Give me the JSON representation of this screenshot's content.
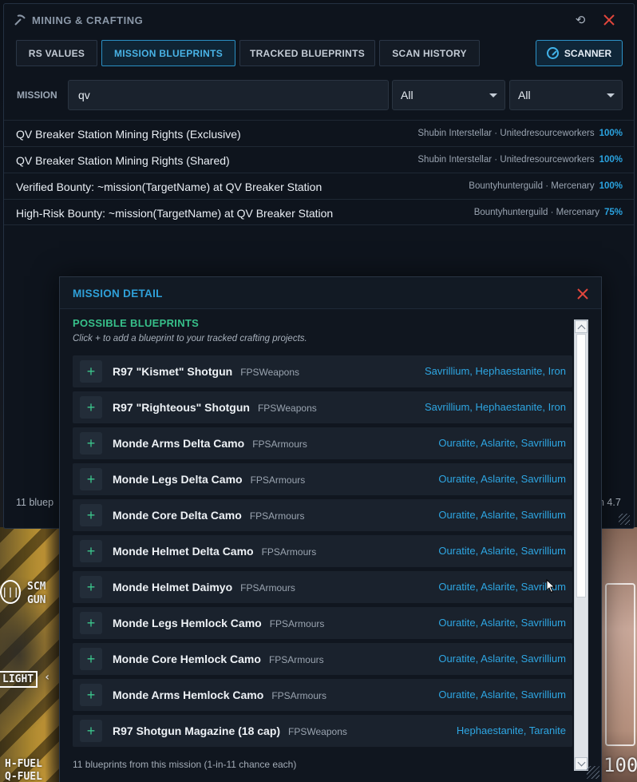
{
  "window": {
    "title": "MINING & CRAFTING",
    "tabs": [
      {
        "label": "RS VALUES",
        "active": false
      },
      {
        "label": "MISSION BLUEPRINTS",
        "active": true
      },
      {
        "label": "TRACKED BLUEPRINTS",
        "active": false
      },
      {
        "label": "SCAN HISTORY",
        "active": false
      }
    ],
    "scanner_label": "SCANNER"
  },
  "filters": {
    "label": "MISSION",
    "search_value": "qv",
    "select_1": "All",
    "select_2": "All"
  },
  "results": [
    {
      "title": "QV Breaker Station Mining Rights (Exclusive)",
      "company": "Shubin Interstellar",
      "faction": "Unitedresourceworkers",
      "chance": "100%"
    },
    {
      "title": "QV Breaker Station Mining Rights (Shared)",
      "company": "Shubin Interstellar",
      "faction": "Unitedresourceworkers",
      "chance": "100%"
    },
    {
      "title": "Verified Bounty: ~mission(TargetName) at QV Breaker Station",
      "company": "Bountyhunterguild",
      "faction": "Mercenary",
      "chance": "100%"
    },
    {
      "title": "High-Risk Bounty: ~mission(TargetName) at QV Breaker Station",
      "company": "Bountyhunterguild",
      "faction": "Mercenary",
      "chance": "75%"
    }
  ],
  "footer": {
    "left": "11 bluep",
    "right": "n 4.7"
  },
  "modal": {
    "title": "MISSION DETAIL",
    "section_title": "POSSIBLE BLUEPRINTS",
    "hint": "Click + to add a blueprint to your tracked crafting projects.",
    "add_symbol": "+",
    "blueprints": [
      {
        "name": "R97 \"Kismet\" Shotgun",
        "category": "FPSWeapons",
        "materials": "Savrillium, Hephaestanite, Iron"
      },
      {
        "name": "R97 \"Righteous\" Shotgun",
        "category": "FPSWeapons",
        "materials": "Savrillium, Hephaestanite, Iron"
      },
      {
        "name": "Monde Arms Delta Camo",
        "category": "FPSArmours",
        "materials": "Ouratite, Aslarite, Savrillium"
      },
      {
        "name": "Monde Legs Delta Camo",
        "category": "FPSArmours",
        "materials": "Ouratite, Aslarite, Savrillium"
      },
      {
        "name": "Monde Core Delta Camo",
        "category": "FPSArmours",
        "materials": "Ouratite, Aslarite, Savrillium"
      },
      {
        "name": "Monde Helmet Delta Camo",
        "category": "FPSArmours",
        "materials": "Ouratite, Aslarite, Savrillium"
      },
      {
        "name": "Monde Helmet Daimyo",
        "category": "FPSArmours",
        "materials": "Ouratite, Aslarite, Savrillium"
      },
      {
        "name": "Monde Legs Hemlock Camo",
        "category": "FPSArmours",
        "materials": "Ouratite, Aslarite, Savrillium"
      },
      {
        "name": "Monde Core Hemlock Camo",
        "category": "FPSArmours",
        "materials": "Ouratite, Aslarite, Savrillium"
      },
      {
        "name": "Monde Arms Hemlock Camo",
        "category": "FPSArmours",
        "materials": "Ouratite, Aslarite, Savrillium"
      },
      {
        "name": "R97 Shotgun Magazine (18 cap)",
        "category": "FPSWeapons",
        "materials": "Hephaestanite, Taranite"
      }
    ],
    "footer": "11 blueprints from this mission (1-in-11 chance each)"
  },
  "hud": {
    "scm": "SCM",
    "gun": "GUN",
    "light": "LIGHT",
    "hfuel": "H-FUEL",
    "qfuel": "Q-FUEL",
    "value": "100"
  },
  "colors": {
    "accent": "#2fa0d8",
    "section_green": "#37c08a",
    "close_red": "#e2463c",
    "panel_bg": "#0e141d"
  },
  "icons": {
    "title": "pickaxe-icon",
    "refresh": "refresh-icon",
    "close": "close-icon",
    "scanner": "radar-icon",
    "dropdown": "chevron-down-icon"
  }
}
